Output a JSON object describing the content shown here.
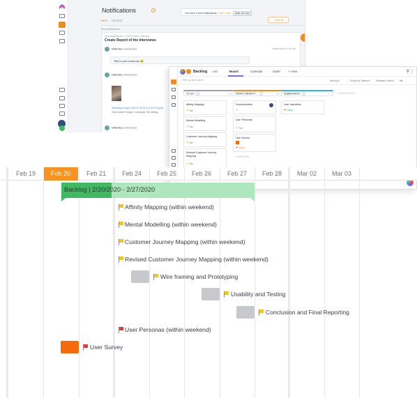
{
  "notifications": {
    "title": "Notifications",
    "banner_text": "You have 4 new notifications.",
    "banner_link": "Learn more",
    "banner_button": "Mark all read",
    "view_all": "View all",
    "tabs": [
      "New",
      "Cleared"
    ],
    "section": "Rest Notifications",
    "breadcrumb": "Inbox/Notifications > UX/UI Project > Backlog",
    "task_title": "Create Report of the Interviews",
    "comment1_author": "Niharika",
    "comment1_verb": "commented",
    "comment1_time": "Yesterday at 10:41 am",
    "comment1_text": "Talk to you tomorrow 😀",
    "comment2_author": "Niharika",
    "comment2_verb": "commented",
    "attachment": "WhatsApp Image 2020-02-18 at 8.21.54 PM.jpeg",
    "message": "Only doesn't image I could get. My sibling...",
    "comment3_author": "Niharika",
    "comment3_verb": "commented"
  },
  "board": {
    "title": "Backlog",
    "views": [
      "List",
      "Board",
      "Calendar",
      "Gantt",
      "+ View"
    ],
    "filter_placeholder": "Filter by task name...",
    "options": [
      "Sort by ▾",
      "Group by: Status ▾",
      "Subtasks: Hide ▾",
      "Me"
    ],
    "new_status": "+ NEW STATUS",
    "columns": [
      {
        "name": "TO DO",
        "count": "4",
        "cards": [
          {
            "title": "Affinity Mapping",
            "flag": "yellow",
            "foot": "Tue"
          },
          {
            "title": "Mental Modelling",
            "flag": "yellow",
            "foot": "Tue"
          },
          {
            "title": "Customer Journey Mapping",
            "flag": "yellow",
            "foot": "Tue"
          },
          {
            "title": "Revised Customer Journey Mapping",
            "flag": "yellow",
            "foot": "Tue"
          }
        ],
        "new_task": "+ NEW TASK"
      },
      {
        "name": "WORK UNDER P...",
        "count": "3",
        "cards": [
          {
            "title": "Documentation",
            "flag": "yellow",
            "foot": ""
          },
          {
            "title": "User Personas",
            "flag": "yellow",
            "foot": "Tue"
          },
          {
            "title": "User Survey",
            "flag": "red",
            "foot": "Today"
          }
        ],
        "new_task": "+ NEW TASK"
      },
      {
        "name": "SUBMISSION",
        "count": "1",
        "cards": [
          {
            "title": "User Interviews",
            "flag": "red",
            "foot": "Today"
          }
        ],
        "new_task": ""
      }
    ]
  },
  "gantt": {
    "days": [
      "Feb 19",
      "Feb 20",
      "Feb 21",
      "Feb 24",
      "Feb 25",
      "Feb 26",
      "Feb 27",
      "Feb 28",
      "Mar 02",
      "Mar 03"
    ],
    "today": "Feb 20",
    "group_label": "Backlog | 2/20/2020 - 2/27/2020",
    "group_progress": 0.26,
    "tasks": [
      {
        "name": "Affinity Mapping (within weekend)",
        "flag": "yellow"
      },
      {
        "name": "Mental Modelling (within weekend)",
        "flag": "yellow"
      },
      {
        "name": "Customer Journey Mapping (within weekend)",
        "flag": "yellow"
      },
      {
        "name": "Revised Customer Journey Mapping (within weekend)",
        "flag": "yellow"
      },
      {
        "name": "Wire framing and Prototyping",
        "flag": "yellow"
      },
      {
        "name": "Usability and Testing",
        "flag": "yellow"
      },
      {
        "name": "Conclusion and Final Reporting",
        "flag": "yellow"
      },
      {
        "name": "User Personas (within weekend)",
        "flag": "red"
      },
      {
        "name": "User Survey",
        "flag": "red"
      }
    ],
    "colors": {
      "today": "#f7931e",
      "bar": "#3fba62",
      "bar_light": "#aee6bd",
      "flag_yellow": "#f5c518",
      "flag_red": "#e53935",
      "block_gray": "#c8c9ce",
      "block_orange": "#f56a0c"
    }
  }
}
